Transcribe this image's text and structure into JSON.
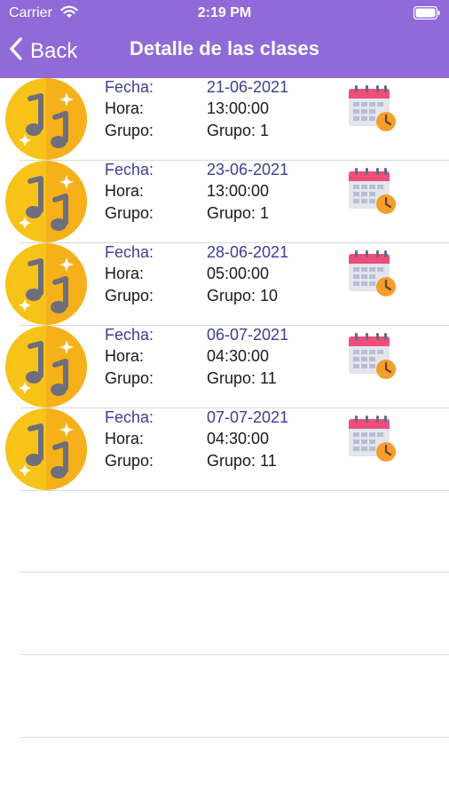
{
  "status_bar": {
    "carrier": "Carrier",
    "time": "2:19 PM"
  },
  "nav": {
    "back_label": "Back",
    "title": "Detalle de las clases"
  },
  "colors": {
    "header": "#8f6ad8",
    "accent_text": "#3d3d93"
  },
  "labels": {
    "fecha": "Fecha:",
    "hora": "Hora:",
    "grupo": "Grupo:"
  },
  "classes": [
    {
      "fecha": "21-06-2021",
      "hora": "13:00:00",
      "grupo": "Grupo: 1"
    },
    {
      "fecha": "23-06-2021",
      "hora": "13:00:00",
      "grupo": "Grupo: 1"
    },
    {
      "fecha": "28-06-2021",
      "hora": "05:00:00",
      "grupo": "Grupo: 10"
    },
    {
      "fecha": "06-07-2021",
      "hora": "04:30:00",
      "grupo": "Grupo: 11"
    },
    {
      "fecha": "07-07-2021",
      "hora": "04:30:00",
      "grupo": "Grupo: 11"
    }
  ],
  "icons": {
    "avatar": "music-note-icon",
    "calendar": "calendar-clock-icon"
  }
}
